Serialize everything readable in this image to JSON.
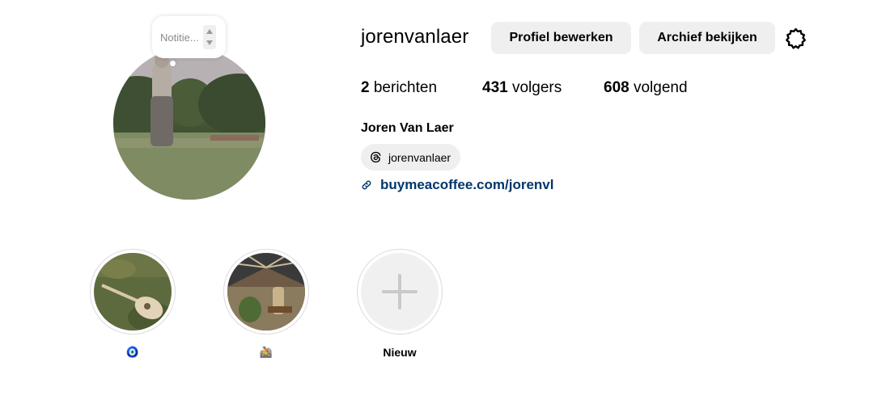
{
  "profile": {
    "username": "jorenvanlaer",
    "full_name": "Joren Van Laer",
    "note_placeholder": "Notitie...",
    "threads_handle": "jorenvanlaer",
    "link": "buymeacoffee.com/jorenvl"
  },
  "actions": {
    "edit_profile": "Profiel bewerken",
    "view_archive": "Archief bekijken",
    "settings_icon": "gear-icon"
  },
  "stats": {
    "posts_count": "2",
    "posts_label": "berichten",
    "followers_count": "431",
    "followers_label": "volgers",
    "following_count": "608",
    "following_label": "volgend"
  },
  "highlights": [
    {
      "label": "🧿"
    },
    {
      "label": "🚵"
    },
    {
      "label": "Nieuw"
    }
  ],
  "colors": {
    "button_bg": "#efefef",
    "link": "#00376b",
    "ring": "#dbdbdb"
  }
}
